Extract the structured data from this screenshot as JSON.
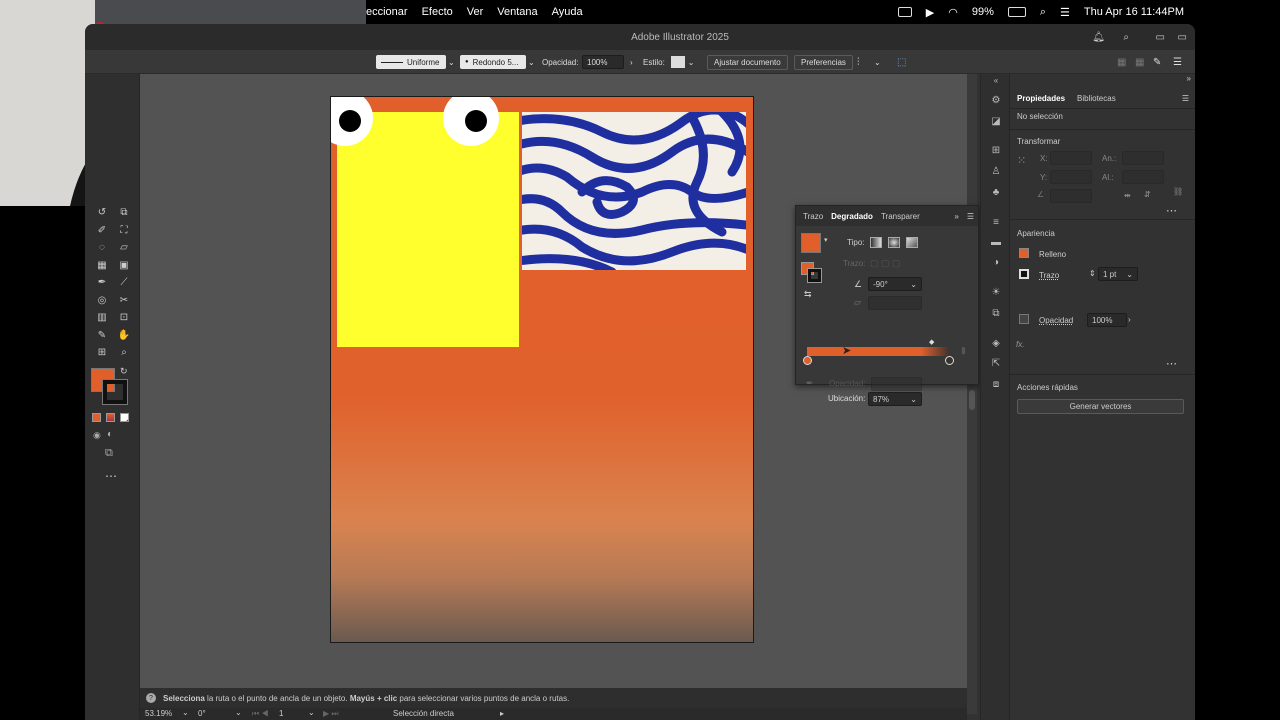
{
  "menubar": {
    "menus": [
      "eccionar",
      "Efecto",
      "Ver",
      "Ventana",
      "Ayuda"
    ],
    "battery": "99%",
    "clock": "Thu Apr 16  11:44PM"
  },
  "app": {
    "title": "Adobe Illustrator 2025"
  },
  "control_bar": {
    "stroke_profile": "Uniforme",
    "brush": "Redondo 5...",
    "opacity_label": "Opacidad:",
    "opacity_value": "100%",
    "style_label": "Estilo:",
    "fit_document": "Ajustar documento",
    "preferences": "Preferencias"
  },
  "gradient_panel": {
    "tabs": [
      "Trazo",
      "Degradado",
      "Transparer"
    ],
    "type_label": "Tipo:",
    "stroke_label": "Trazo:",
    "angle_value": "-90°",
    "opacity_label": "Opacidad:",
    "location_label": "Ubicación:",
    "location_value": "87%",
    "start_color": "#e15f2a",
    "end_color": "#3a3330"
  },
  "properties": {
    "tabs": [
      "Propiedades",
      "Bibliotecas"
    ],
    "selection": "No selección",
    "transform_title": "Transformar",
    "x_label": "X:",
    "y_label": "Y:",
    "w_label": "An.:",
    "h_label": "Al.:",
    "appearance_title": "Apariencia",
    "fill_label": "Relleno",
    "stroke_label": "Trazo",
    "stroke_value": "1 pt",
    "opacity_label": "Opacidad",
    "opacity_value": "100%",
    "fx": "fx.",
    "quick_actions_title": "Acciones rápidas",
    "generate_vectors": "Generar vectores"
  },
  "status": {
    "hint_bold1": "Selecciona",
    "hint1": " la ruta o el punto de ancla de un objeto.",
    "hint_bold2": " Mayús + clic",
    "hint2": " para seleccionar varios puntos de ancla o rutas.",
    "zoom": "53.19%",
    "rotation": "0°",
    "artboard": "1",
    "tool": "Selección directa"
  },
  "colors": {
    "fill": "#e15f2a",
    "stroke": "#1a1a1a",
    "accent_yellow": "#ffff2e",
    "zebra_blue": "#1f2fa0"
  }
}
